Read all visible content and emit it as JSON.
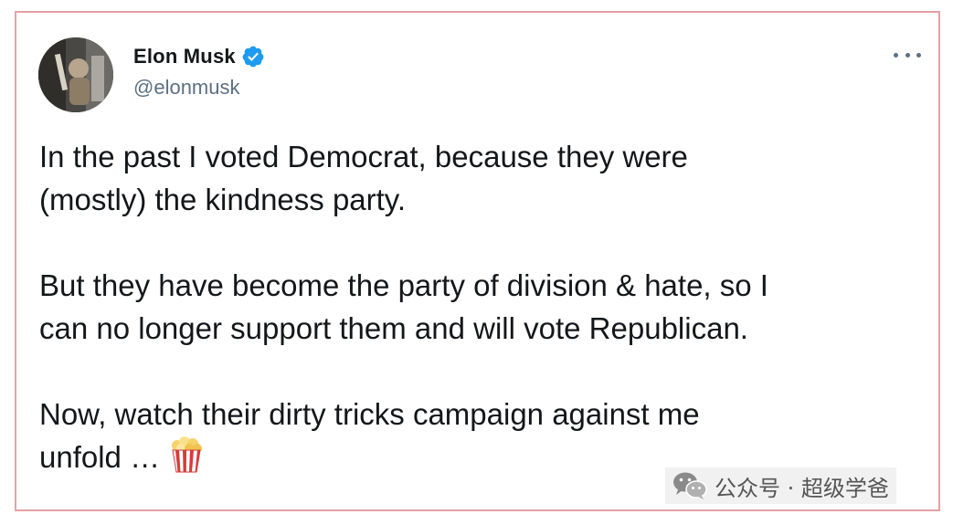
{
  "tweet": {
    "author": {
      "display_name": "Elon Musk",
      "handle": "@elonmusk",
      "verified": true,
      "avatar_icon": "profile-photo"
    },
    "more_icon": "ellipsis-icon",
    "paragraphs": [
      "In the past I voted Democrat, because they were\n(mostly) the kindness party.",
      "But they have become the party of division & hate, so I\ncan no longer support them and will vote Republican.",
      "Now, watch their dirty tricks campaign against me\nunfold …"
    ],
    "emoji": "popcorn"
  },
  "watermark": {
    "icon": "wechat-icon",
    "text": "公众号 · 超级学爸"
  },
  "colors": {
    "border": "#e5a0a5",
    "verified_blue": "#1d9bf0",
    "text_primary": "#14171a",
    "text_secondary": "#5b7083"
  }
}
